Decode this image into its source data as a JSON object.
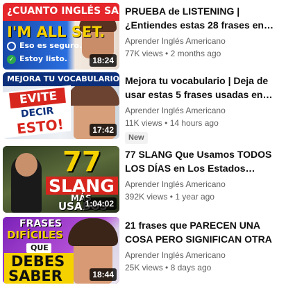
{
  "videos": [
    {
      "title": "PRUEBA de LISTENING | ¿Entiendes estas 28 frases en…",
      "channel": "Aprender Inglés Americano",
      "views": "77K views",
      "age": "2 months ago",
      "duration": "18:24",
      "thumb": {
        "banner": "¿CUANTO INGLÉS SABES?",
        "big": "I'M ALL SET.",
        "opt1": "Eso es seguro.",
        "opt2": "Estoy listo."
      }
    },
    {
      "title": "Mejora tu vocabulario | Deja de usar estas 5 frases usadas en…",
      "channel": "Aprender Inglés Americano",
      "views": "11K views",
      "age": "14 hours ago",
      "badge": "New",
      "duration": "17:42",
      "thumb": {
        "banner": "MEJORA TU VOCABULARIO",
        "line1": "EVITE",
        "line2": "DECIR",
        "line3": "ESTO!"
      }
    },
    {
      "title": "77 SLANG Que Usamos TODOS LOS DÍAS en Los Estados…",
      "channel": "Aprender Inglés Americano",
      "views": "392K views",
      "age": "1 year ago",
      "duration": "1:04:02",
      "thumb": {
        "num": "77",
        "word": "SLANG",
        "small1": "MÁS",
        "small2": "USADOS"
      }
    },
    {
      "title": "21 frases que PARECEN UNA COSA PERO SIGNIFICAN OTRA",
      "channel": "Aprender Inglés Americano",
      "views": "25K views",
      "age": "8 days ago",
      "duration": "18:44",
      "thumb": {
        "line1": "FRASES",
        "line2": "DIFÍCILES",
        "line3": "QUE",
        "line4": "DEBES",
        "line5": "SABER"
      }
    }
  ],
  "separator": "•",
  "colors": {
    "title": "#0f0f0f",
    "secondary": "#606060",
    "thumb1_bg": "#1c5fcf",
    "thumb1_banner": "#e5262b",
    "thumb2_banner": "#0b2f7a",
    "thumb2_red": "#d7261e",
    "thumb3_accent": "#f5d100",
    "thumb4_accent": "#f5d100"
  }
}
